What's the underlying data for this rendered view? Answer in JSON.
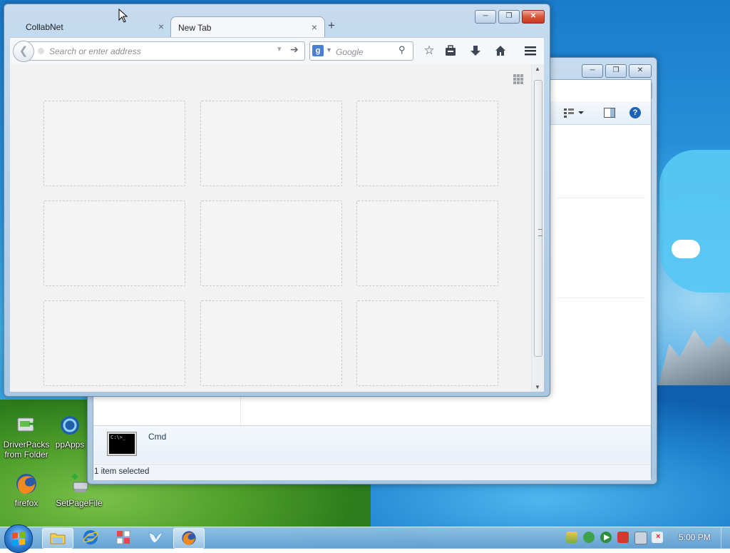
{
  "firefox": {
    "tabs": [
      {
        "label": "CollabNet",
        "active": false
      },
      {
        "label": "New Tab",
        "active": true
      }
    ],
    "url_placeholder": "Search or enter address",
    "search_engine_icon": "google-g",
    "search_placeholder": "Google",
    "toolbar_icons": [
      "bookmark-star-icon",
      "reading-list-icon",
      "downloads-icon",
      "home-icon",
      "menu-icon"
    ],
    "new_tab_tiles": 9
  },
  "explorer": {
    "selected_item": "Cmd",
    "status": "1 item selected"
  },
  "desktop": {
    "icons": [
      {
        "label": "DriverPacks from Folder"
      },
      {
        "label": "ppApps"
      },
      {
        "label": "firefox"
      },
      {
        "label": "SetPageFile"
      }
    ]
  },
  "taskbar": {
    "clock": "5:00 PM",
    "pinned": [
      "windows-explorer",
      "internet-explorer",
      "app-grid",
      "bird-app",
      "firefox"
    ]
  },
  "colors": {
    "accent": "#1d62b7",
    "close_button": "#c8391f",
    "taskbar": "#6ea5d2"
  }
}
